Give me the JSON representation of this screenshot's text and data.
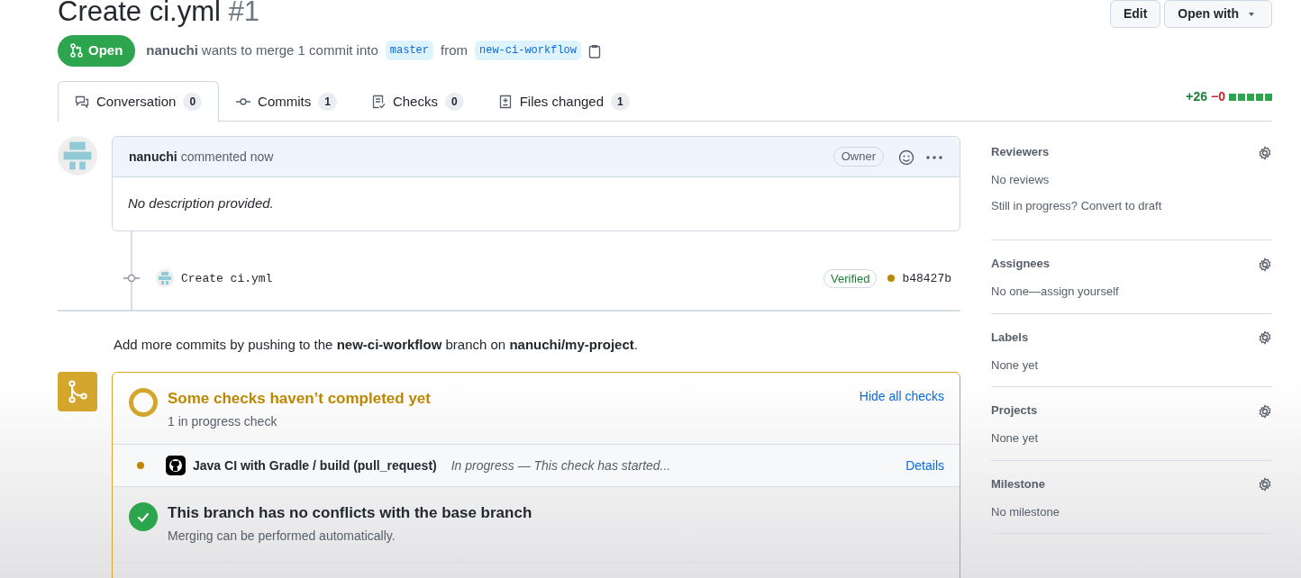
{
  "header": {
    "title": "Create ci.yml",
    "number": "#1",
    "buttons": [
      {
        "label": "Edit",
        "kind": "plain"
      },
      {
        "label": "Open with",
        "kind": "dropdown"
      }
    ]
  },
  "state_badge": {
    "label": "Open"
  },
  "merge_summary": {
    "author": "nanuchi",
    "phrase": "wants to merge 1 commit into",
    "base_branch": "master",
    "connector": "from",
    "head_branch": "new-ci-workflow"
  },
  "tabs": [
    {
      "label": "Conversation",
      "count": "0",
      "kind": "conversation",
      "selected": true
    },
    {
      "label": "Commits",
      "count": "1",
      "kind": "commits",
      "selected": false
    },
    {
      "label": "Checks",
      "count": "0",
      "kind": "checks",
      "selected": false
    },
    {
      "label": "Files changed",
      "count": "1",
      "kind": "files",
      "selected": false
    }
  ],
  "diffstat": {
    "additions": "+26",
    "deletions": "−0"
  },
  "comment": {
    "author": "nanuchi",
    "action": "commented now",
    "role": "Owner",
    "body": "No description provided."
  },
  "commit": {
    "message": "Create ci.yml",
    "verification": "Verified",
    "sha": "b48427b"
  },
  "push_hint": "Add more commits by pushing to the **new-ci-workflow** branch on **nanuchi/my-project**.",
  "checks": {
    "title": "Some checks haven’t completed yet",
    "subtitle": "1 in progress check",
    "toggle": "Hide all checks",
    "items": [
      {
        "name": "Java CI with Gradle / build (pull_request)",
        "status": "In progress — This check has started...",
        "link": "Details"
      }
    ],
    "merge_status": {
      "title": "This branch has no conflicts with the base branch",
      "subtitle": "Merging can be performed automatically."
    }
  },
  "sidebar": [
    {
      "title": "Reviewers",
      "lines": [
        "No reviews",
        "Still in progress? Convert to draft"
      ]
    },
    {
      "title": "Assignees",
      "lines": [
        "No one—assign yourself"
      ]
    },
    {
      "title": "Labels",
      "lines": [
        "None yet"
      ]
    },
    {
      "title": "Projects",
      "lines": [
        "None yet"
      ]
    },
    {
      "title": "Milestone",
      "lines": [
        "No milestone"
      ]
    }
  ]
}
